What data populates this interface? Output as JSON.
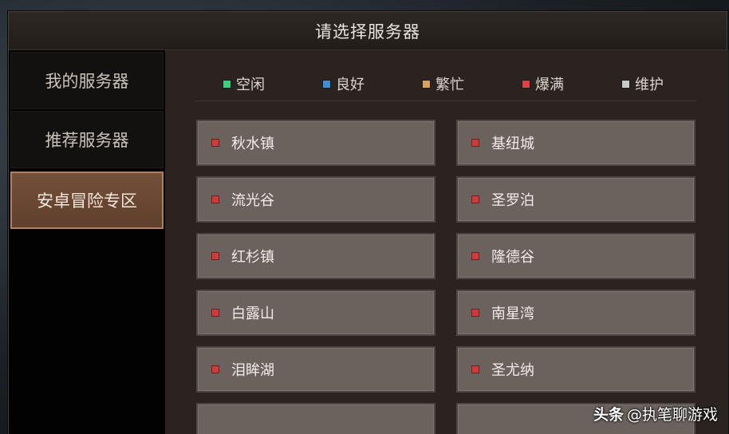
{
  "dialog": {
    "title": "请选择服务器"
  },
  "sidebar": {
    "items": [
      {
        "label": "我的服务器"
      },
      {
        "label": "推荐服务器"
      },
      {
        "label": "安卓冒险专区",
        "active": true
      }
    ]
  },
  "legend": [
    {
      "label": "空闲",
      "color": "#3fcf7a"
    },
    {
      "label": "良好",
      "color": "#3f8fd6"
    },
    {
      "label": "繁忙",
      "color": "#d9a15a"
    },
    {
      "label": "爆满",
      "color": "#d94545"
    },
    {
      "label": "维护",
      "color": "#c9c9c9"
    }
  ],
  "servers": [
    {
      "name": "秋水镇",
      "status": "爆满"
    },
    {
      "name": "基纽城",
      "status": "爆满"
    },
    {
      "name": "流光谷",
      "status": "爆满"
    },
    {
      "name": "圣罗泊",
      "status": "爆满"
    },
    {
      "name": "红杉镇",
      "status": "爆满"
    },
    {
      "name": "隆德谷",
      "status": "爆满"
    },
    {
      "name": "白露山",
      "status": "爆满"
    },
    {
      "name": "南星湾",
      "status": "爆满"
    },
    {
      "name": "泪眸湖",
      "status": "爆满"
    },
    {
      "name": "圣尤纳",
      "status": "爆满"
    }
  ],
  "watermark": {
    "brand": "头条",
    "handle": "@执笔聊游戏"
  }
}
